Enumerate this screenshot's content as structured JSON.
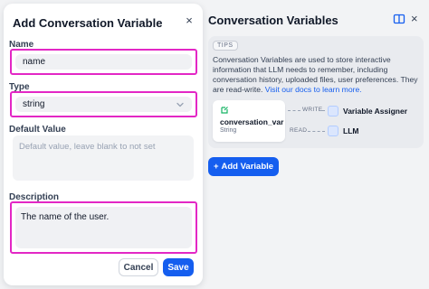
{
  "modal": {
    "title": "Add Conversation Variable",
    "close_icon": "×",
    "name_label": "Name",
    "name_value": "name",
    "type_label": "Type",
    "type_value": "string",
    "default_label": "Default Value",
    "default_placeholder": "Default value, leave blank to not set",
    "description_label": "Description",
    "description_value": "The name of the user.",
    "cancel_label": "Cancel",
    "save_label": "Save"
  },
  "panel": {
    "title": "Conversation Variables",
    "close_icon": "×",
    "tips_badge": "TIPS",
    "tips_text": "Conversation Variables are used to store interactive information that LLM needs to remember, including conversation history, uploaded files, user preferences. They are read-write. ",
    "tips_link": "Visit our docs to learn more.",
    "var_name": "conversation_var",
    "var_type": "String",
    "write_label": "WRITE",
    "read_label": "READ",
    "write_node": "Variable Assigner",
    "read_node": "LLM",
    "add_button": "Add Variable",
    "add_icon": "+"
  },
  "colors": {
    "accent": "#155eef",
    "highlight": "#e327c5"
  }
}
